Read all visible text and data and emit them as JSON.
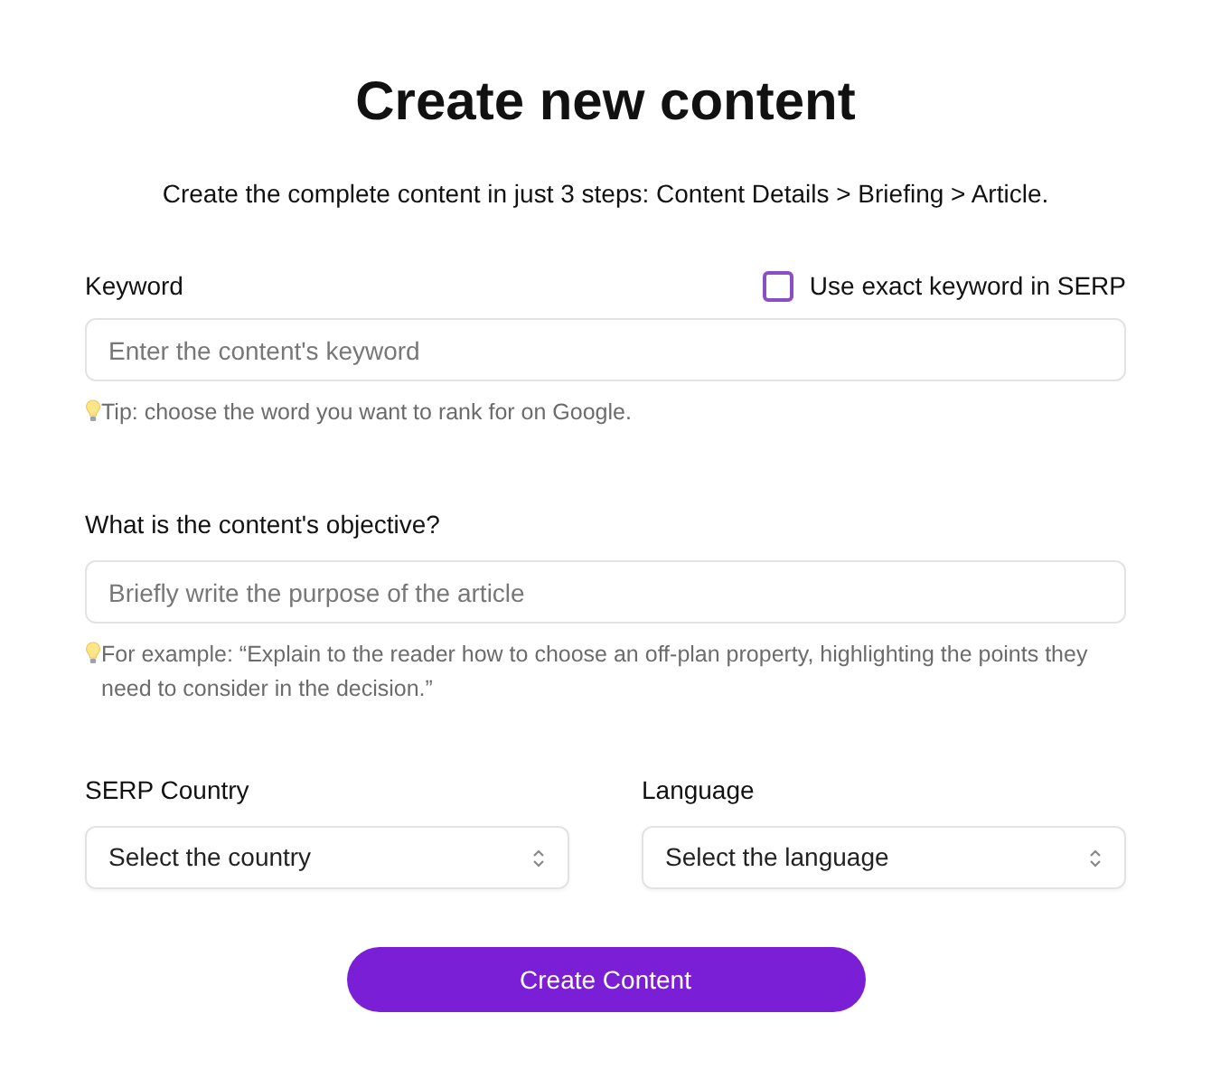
{
  "title": "Create new content",
  "subtitle": "Create the complete content in just 3 steps: Content Details > Briefing > Article.",
  "keyword": {
    "label": "Keyword",
    "placeholder": "Enter the content's keyword",
    "hint": "Tip: choose the word you want to rank for on Google.",
    "exact_match": {
      "label": "Use exact keyword in SERP",
      "checked": false
    }
  },
  "objective": {
    "label": "What is the content's objective?",
    "placeholder": "Briefly write the purpose of the article",
    "hint": "For example: “Explain to the reader how to choose an off-plan property, highlighting the points they need to consider in the decision.”"
  },
  "selects": [
    {
      "label": "SERP Country",
      "placeholder": "Select the country"
    },
    {
      "label": "Language",
      "placeholder": "Select the language"
    }
  ],
  "submit": "Create Content"
}
